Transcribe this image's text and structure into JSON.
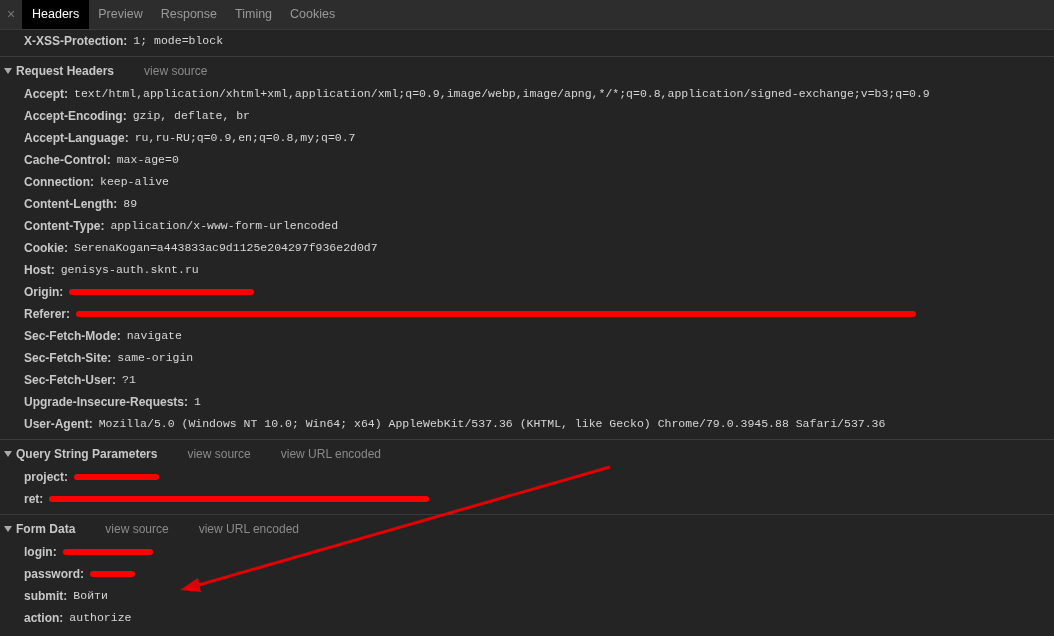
{
  "tabs": [
    {
      "label": "Headers",
      "selected": true
    },
    {
      "label": "Preview",
      "selected": false
    },
    {
      "label": "Response",
      "selected": false
    },
    {
      "label": "Timing",
      "selected": false
    },
    {
      "label": "Cookies",
      "selected": false
    }
  ],
  "close_label": "×",
  "top_headers": [
    {
      "name": "X-XSS-Protection:",
      "value": "1; mode=block",
      "redacted": false
    }
  ],
  "sections": [
    {
      "title": "Request Headers",
      "expanded": true,
      "links": [
        "view source"
      ],
      "items": [
        {
          "name": "Accept:",
          "value": "text/html,application/xhtml+xml,application/xml;q=0.9,image/webp,image/apng,*/*;q=0.8,application/signed-exchange;v=b3;q=0.9",
          "redacted": false
        },
        {
          "name": "Accept-Encoding:",
          "value": "gzip, deflate, br",
          "redacted": false
        },
        {
          "name": "Accept-Language:",
          "value": "ru,ru-RU;q=0.9,en;q=0.8,my;q=0.7",
          "redacted": false
        },
        {
          "name": "Cache-Control:",
          "value": "max-age=0",
          "redacted": false
        },
        {
          "name": "Connection:",
          "value": "keep-alive",
          "redacted": false
        },
        {
          "name": "Content-Length:",
          "value": "89",
          "redacted": false
        },
        {
          "name": "Content-Type:",
          "value": "application/x-www-form-urlencoded",
          "redacted": false
        },
        {
          "name": "Cookie:",
          "value": "SerenaKogan=a443833ac9d1125e204297f936e2d0d7",
          "redacted": false
        },
        {
          "name": "Host:",
          "value": "genisys-auth.sknt.ru",
          "redacted": false
        },
        {
          "name": "Origin:",
          "redacted": true
        },
        {
          "name": "Referer:",
          "redacted": true
        },
        {
          "name": "Sec-Fetch-Mode:",
          "value": "navigate",
          "redacted": false
        },
        {
          "name": "Sec-Fetch-Site:",
          "value": "same-origin",
          "redacted": false
        },
        {
          "name": "Sec-Fetch-User:",
          "value": "?1",
          "redacted": false
        },
        {
          "name": "Upgrade-Insecure-Requests:",
          "value": "1",
          "redacted": false
        },
        {
          "name": "User-Agent:",
          "value": "Mozilla/5.0 (Windows NT 10.0; Win64; x64) AppleWebKit/537.36 (KHTML, like Gecko) Chrome/79.0.3945.88 Safari/537.36",
          "redacted": false
        }
      ]
    },
    {
      "title": "Query String Parameters",
      "expanded": true,
      "links": [
        "view source",
        "view URL encoded"
      ],
      "items": [
        {
          "name": "project:",
          "redacted": true
        },
        {
          "name": "ret:",
          "redacted": true
        }
      ]
    },
    {
      "title": "Form Data",
      "expanded": true,
      "links": [
        "view source",
        "view URL encoded"
      ],
      "items": [
        {
          "name": "login:",
          "redacted": true
        },
        {
          "name": "password:",
          "redacted": true
        },
        {
          "name": "submit:",
          "value": "Войти",
          "redacted": false
        },
        {
          "name": "action:",
          "value": "authorize",
          "redacted": false
        }
      ]
    }
  ]
}
